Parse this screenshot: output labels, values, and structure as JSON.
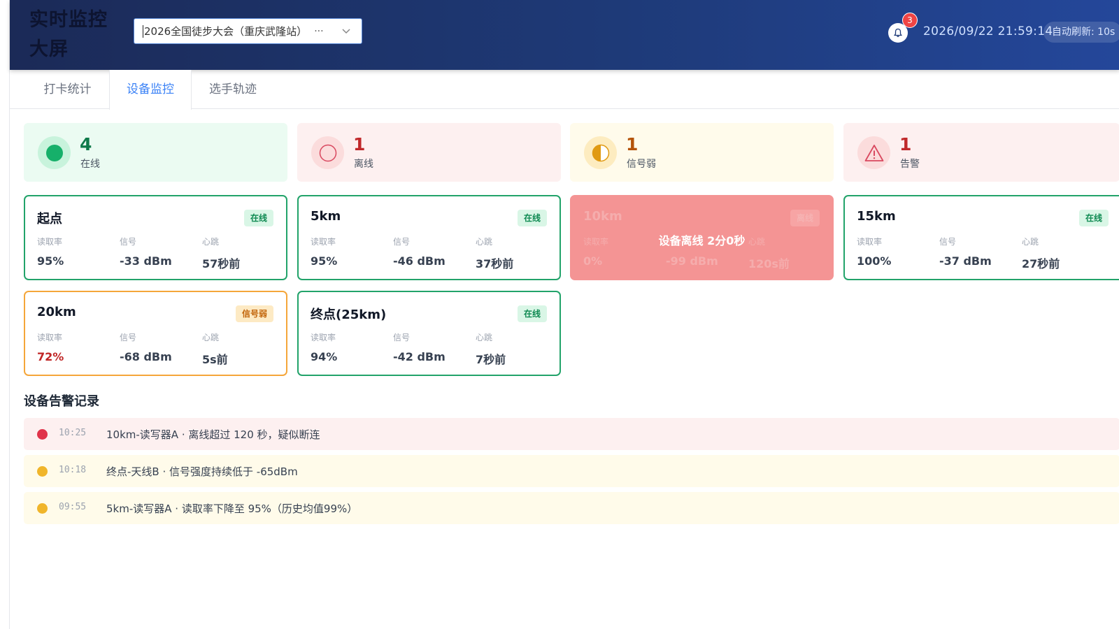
{
  "header": {
    "title_line1": "实时监控",
    "title_line2": "大屏",
    "event_selected": "2026全国徒步大会（重庆武隆站）",
    "event_overflow": "···",
    "notification_count": "3",
    "datetime": "2026/09/22 21:59:14",
    "auto_refresh": "自动刷新: 10s"
  },
  "tabs": [
    {
      "label": "打卡统计",
      "active": false
    },
    {
      "label": "设备监控",
      "active": true
    },
    {
      "label": "选手轨迹",
      "active": false
    }
  ],
  "summary": {
    "online": {
      "count": "4",
      "label": "在线"
    },
    "offline": {
      "count": "1",
      "label": "离线"
    },
    "weak": {
      "count": "1",
      "label": "信号弱"
    },
    "alarm": {
      "count": "1",
      "label": "告警"
    }
  },
  "metric_labels": {
    "read_rate": "读取率",
    "signal": "信号",
    "heartbeat": "心跳"
  },
  "devices": [
    {
      "name": "起点",
      "status": "在线",
      "read_rate": "95%",
      "signal": "-33 dBm",
      "heartbeat": "57秒前"
    },
    {
      "name": "5km",
      "status": "在线",
      "read_rate": "95%",
      "signal": "-46 dBm",
      "heartbeat": "37秒前"
    },
    {
      "name": "10km",
      "status": "离线",
      "read_rate": "0%",
      "signal": "-99 dBm",
      "heartbeat": "120s前",
      "overlay": "设备离线 2分0秒"
    },
    {
      "name": "15km",
      "status": "在线",
      "read_rate": "100%",
      "signal": "-37 dBm",
      "heartbeat": "27秒前"
    },
    {
      "name": "20km",
      "status": "信号弱",
      "read_rate": "72%",
      "signal": "-68 dBm",
      "heartbeat": "5s前"
    },
    {
      "name": "终点(25km)",
      "status": "在线",
      "read_rate": "94%",
      "signal": "-42 dBm",
      "heartbeat": "7秒前"
    }
  ],
  "alarms_title": "设备告警记录",
  "alarms": [
    {
      "time": "10:25",
      "message": "10km-读写器A · 离线超过 120 秒，疑似断连",
      "level": "red"
    },
    {
      "time": "10:18",
      "message": "终点-天线B · 信号强度持续低于 -65dBm",
      "level": "yellow"
    },
    {
      "time": "09:55",
      "message": "5km-读写器A · 读取率下降至 95%（历史均值99%）",
      "level": "yellow"
    }
  ],
  "colors": {
    "header_start": "#1b2a57",
    "header_end": "#24479a",
    "active_tab": "#3b82f6",
    "online": "#22a36a",
    "offline": "#e0334a",
    "weak": "#f5a63a"
  }
}
